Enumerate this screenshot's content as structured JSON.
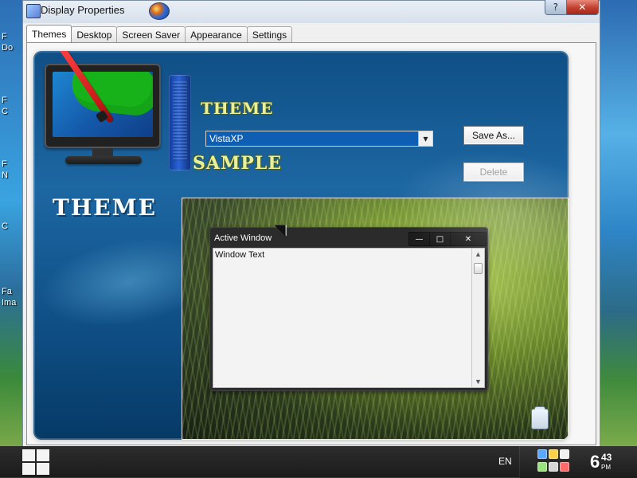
{
  "window": {
    "title": "Display Properties",
    "caption_buttons": {
      "help": "?",
      "close": "✕"
    }
  },
  "tabs": [
    {
      "label": "Themes",
      "active": true
    },
    {
      "label": "Desktop",
      "active": false
    },
    {
      "label": "Screen Saver",
      "active": false
    },
    {
      "label": "Appearance",
      "active": false
    },
    {
      "label": "Settings",
      "active": false
    }
  ],
  "themes_tab": {
    "panel_title": "THEME",
    "theme_label_art": "THEME",
    "sample_label_art": "SAMPLE",
    "theme_dropdown": {
      "selected": "VistaXP"
    },
    "buttons": {
      "save_as": "Save As...",
      "delete": "Delete"
    },
    "preview": {
      "active_window": {
        "title": "Active Window",
        "body_text": "Window Text",
        "controls": {
          "minimize": "—",
          "maximize": "□",
          "close": "✕"
        }
      }
    }
  },
  "taskbar": {
    "language": "EN",
    "clock": {
      "hour": "6",
      "minute": "43",
      "ampm": "PM"
    }
  },
  "desktop": {
    "labels": [
      "F",
      "Do",
      "F",
      "C",
      "F",
      "N",
      "C",
      "Fa",
      "Ima"
    ]
  },
  "colors": {
    "accent_blue": "#0e5fb3",
    "panel_blue": "#0f4f86",
    "taskbar": "#1b1b1b"
  }
}
